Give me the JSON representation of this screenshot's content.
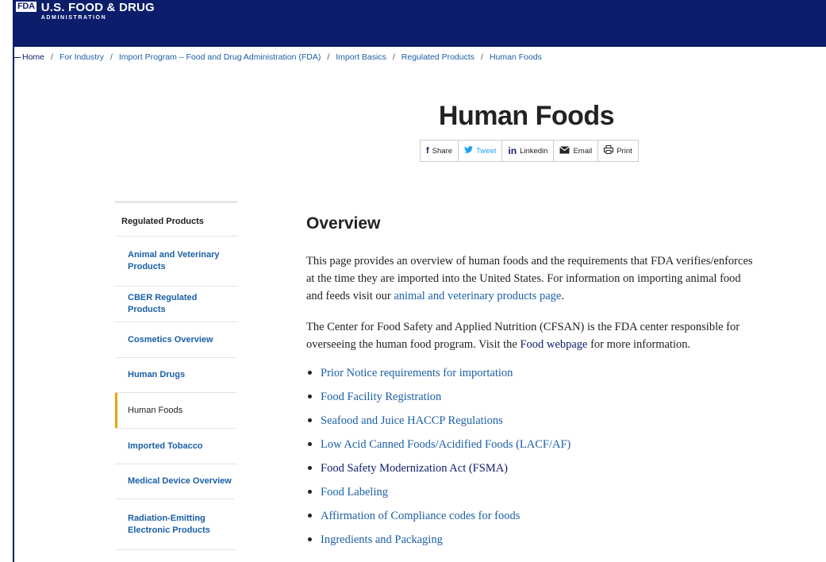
{
  "header": {
    "logo_mark": "FDA",
    "logo_title": "U.S. FOOD & DRUG",
    "logo_sub": "ADMINISTRATION"
  },
  "breadcrumb": {
    "items": [
      "Home",
      "For Industry",
      "Import Program – Food and Drug Administration (FDA)",
      "Import Basics",
      "Regulated Products",
      "Human Foods"
    ],
    "separator": "/"
  },
  "page": {
    "title": "Human Foods"
  },
  "share": [
    {
      "icon": "facebook-icon",
      "glyph": "f",
      "label": "Share"
    },
    {
      "icon": "twitter-icon",
      "glyph": "🐦",
      "label": "Tweet"
    },
    {
      "icon": "linkedin-icon",
      "glyph": "in",
      "label": "Linkedin"
    },
    {
      "icon": "email-icon",
      "glyph": "✉",
      "label": "Email"
    },
    {
      "icon": "print-icon",
      "glyph": "⎙",
      "label": "Print"
    }
  ],
  "sidebar": {
    "heading": "Regulated Products",
    "items": [
      {
        "label": "Animal and Veterinary Products"
      },
      {
        "label": "CBER Regulated Products"
      },
      {
        "label": "Cosmetics Overview"
      },
      {
        "label": "Human Drugs"
      },
      {
        "label": "Human Foods"
      },
      {
        "label": "Imported Tobacco"
      },
      {
        "label": "Medical Device Overview"
      },
      {
        "label": "Radiation-Emitting Electronic Products"
      }
    ]
  },
  "content": {
    "heading": "Overview",
    "para1_text": "This page provides an overview of human foods and the requirements that FDA verifies/enforces at the time they are imported into the United States. For information on importing animal food and feeds visit our ",
    "para1_link": "animal and veterinary products page",
    "para1_end": ".",
    "para2_text": "The Center for Food Safety and Applied Nutrition (CFSAN) is the FDA center responsible for overseeing the human food program. Visit the ",
    "para2_link": "Food webpage",
    "para2_end": " for more information.",
    "bullets": [
      "Prior Notice requirements for importation",
      "Food Facility Registration",
      "Seafood and Juice HACCP Regulations",
      "Low Acid Canned Foods/Acidified Foods (LACF/AF)",
      "Food Safety Modernization Act (FSMA)",
      "Food Labeling",
      "Affirmation of Compliance codes for foods",
      "Ingredients and Packaging"
    ]
  },
  "colors": {
    "header_bg": "#0b1d6b",
    "link": "#1a5fa6",
    "active_marker": "#e7a500"
  }
}
